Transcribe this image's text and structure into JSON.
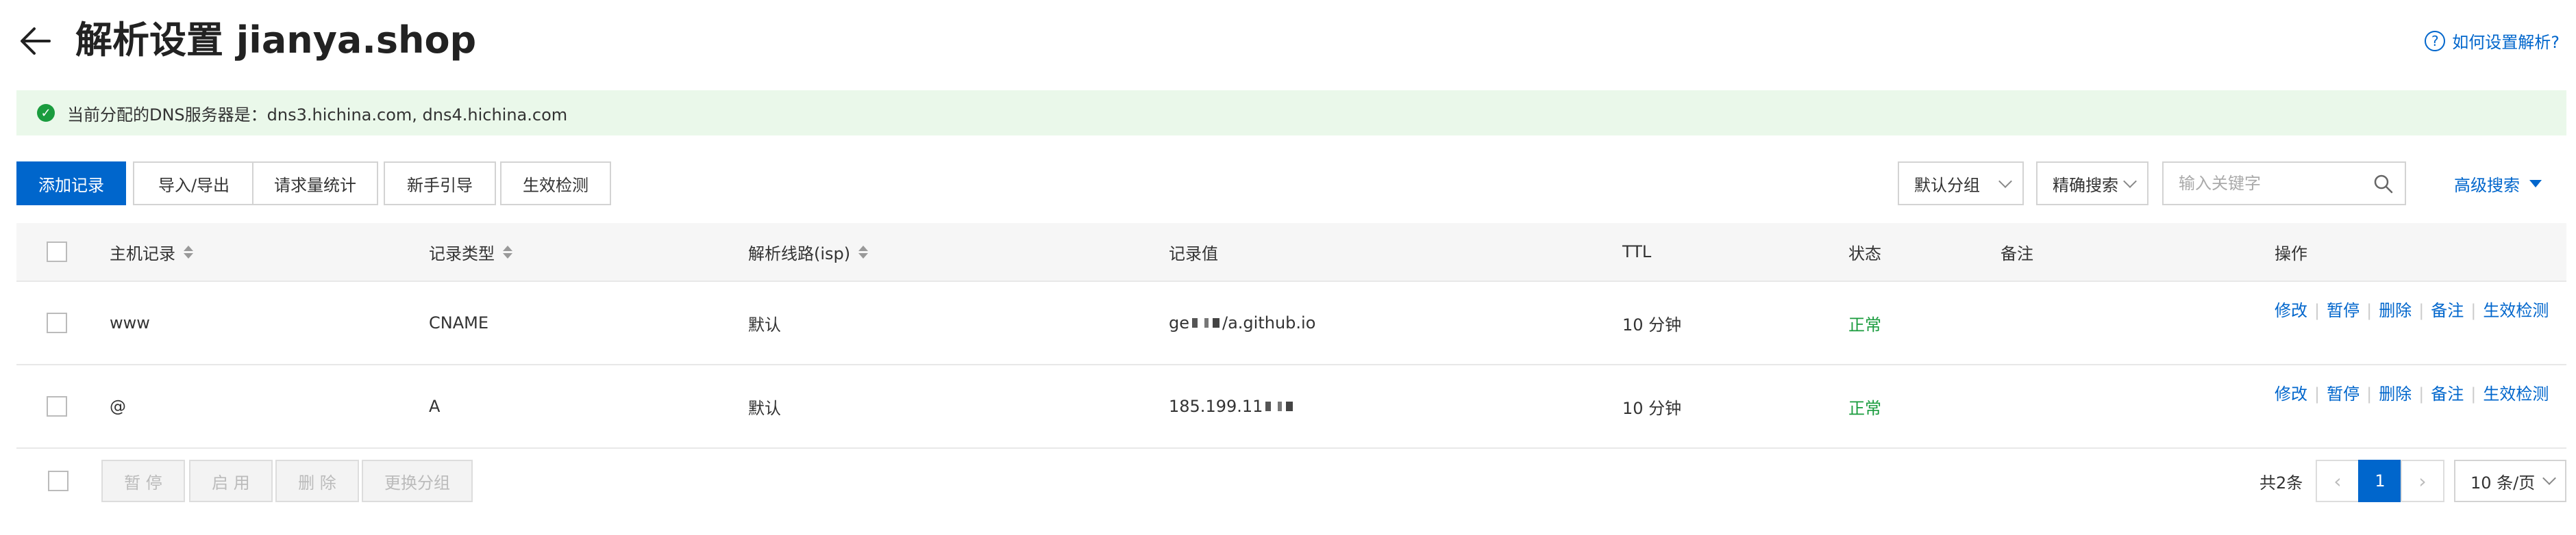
{
  "header": {
    "title": "解析设置 jianya.shop",
    "help_link": "如何设置解析?"
  },
  "banner": {
    "text": "当前分配的DNS服务器是：dns3.hichina.com, dns4.hichina.com"
  },
  "toolbar": {
    "add_record": "添加记录",
    "import_export": "导入/导出",
    "request_stats": "请求量统计",
    "beginner_guide": "新手引导",
    "effect_check": "生效检测",
    "group_select": "默认分组",
    "search_mode": "精确搜索",
    "search_placeholder": "输入关键字",
    "advanced_search": "高级搜索"
  },
  "table": {
    "columns": [
      "主机记录",
      "记录类型",
      "解析线路(isp)",
      "记录值",
      "TTL",
      "状态",
      "备注",
      "操作"
    ],
    "rows": [
      {
        "host": "www",
        "type": "CNAME",
        "line": "默认",
        "value_prefix": "ge",
        "value_suffix": "/a.github.io",
        "ttl": "10 分钟",
        "status": "正常",
        "remark": "",
        "actions": [
          "修改",
          "暂停",
          "删除",
          "备注",
          "生效检测"
        ]
      },
      {
        "host": "@",
        "type": "A",
        "line": "默认",
        "value_prefix": "185.199.11",
        "value_suffix": "",
        "ttl": "10 分钟",
        "status": "正常",
        "remark": "",
        "actions": [
          "修改",
          "暂停",
          "删除",
          "备注",
          "生效检测"
        ]
      }
    ]
  },
  "footer": {
    "pause": "暂 停",
    "enable": "启 用",
    "delete": "删 除",
    "change_group": "更换分组",
    "total": "共2条",
    "current_page": "1",
    "per_page": "10 条/页"
  },
  "colors": {
    "primary": "#0066cc",
    "success": "#1a9c3e",
    "banner_bg": "#eaf8ea"
  },
  "icons": {
    "back": "arrow-left-icon",
    "help": "question-circle-icon",
    "banner": "check-circle-icon",
    "search": "search-icon"
  }
}
